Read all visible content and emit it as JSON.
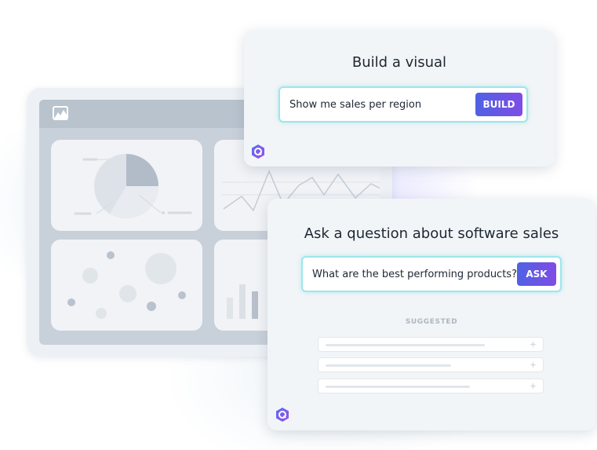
{
  "build_card": {
    "title": "Build a visual",
    "query": "Show me sales per region",
    "button_label": "BUILD"
  },
  "ask_card": {
    "title": "Ask a question about software sales",
    "query": "What are the best performing products?",
    "button_label": "ASK",
    "suggested_label": "SUGGESTED",
    "suggestions": [
      "",
      "",
      ""
    ]
  },
  "icons": {
    "dashboard_logo": "image-icon",
    "assistant": "q-hexagon-icon",
    "suggestion": "sparkle-icon"
  },
  "colors": {
    "accent_start": "#4f62e3",
    "accent_end": "#7f4ce6",
    "input_glow": "#9ee6ec"
  }
}
